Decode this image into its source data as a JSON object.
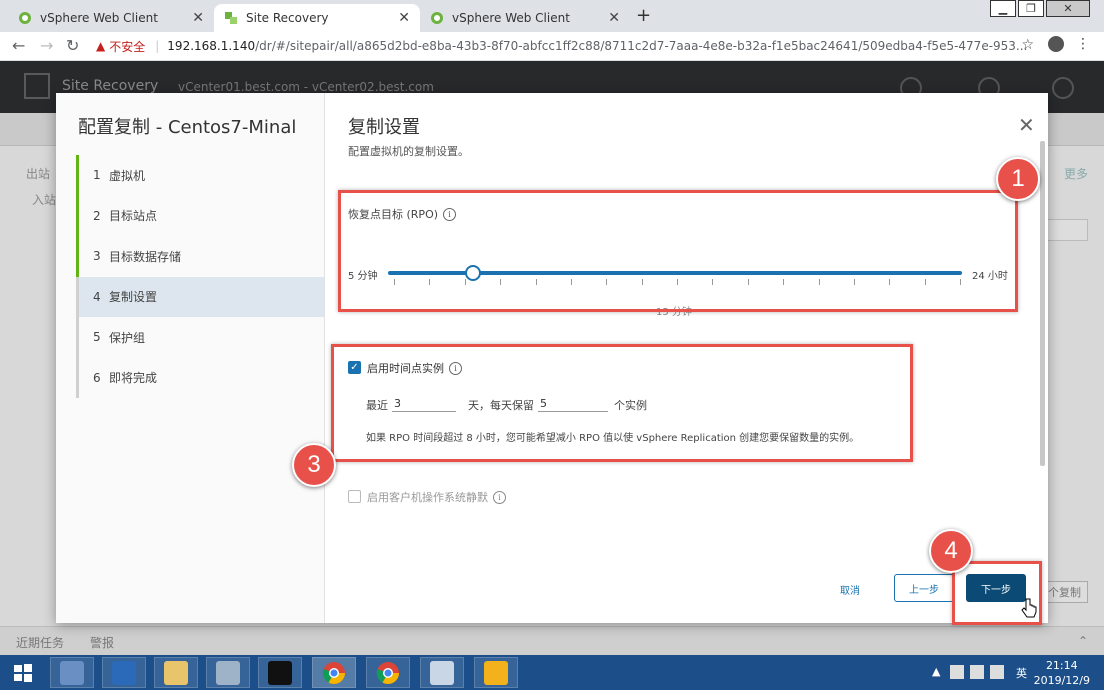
{
  "browser": {
    "tabs": [
      {
        "label": "vSphere Web Client",
        "active": false
      },
      {
        "label": "Site Recovery",
        "active": true
      },
      {
        "label": "vSphere Web Client",
        "active": false
      }
    ],
    "address": {
      "security_label": "不安全",
      "host": "192.168.1.140",
      "path": "/dr/#/sitepair/all/a865d2bd-e8ba-43b3-8f70-abfcc1ff2c88/8711c2d7-7aaa-4e8e-b32a-f1e5bac24641/509edba4-f5e5-477e-953..."
    }
  },
  "app": {
    "title": "Site Recovery",
    "context": "vCenter01.best.com - vCenter02.best.com",
    "bg_left_1": "出站",
    "bg_left_2": "入站",
    "bg_more": "更多",
    "bg_copy": "个复制",
    "tasks": [
      "近期任务",
      "警报"
    ]
  },
  "wizard": {
    "title": "配置复制 - Centos7-Minal",
    "steps": [
      {
        "num": "1",
        "label": "虚拟机",
        "state": "done"
      },
      {
        "num": "2",
        "label": "目标站点",
        "state": "done"
      },
      {
        "num": "3",
        "label": "目标数据存储",
        "state": "done"
      },
      {
        "num": "4",
        "label": "复制设置",
        "state": "current"
      },
      {
        "num": "5",
        "label": "保护组",
        "state": "todo"
      },
      {
        "num": "6",
        "label": "即将完成",
        "state": "todo"
      }
    ],
    "page_title": "复制设置",
    "page_subtitle": "配置虚拟机的复制设置。",
    "rpo": {
      "label": "恢复点目标 (RPO)",
      "min_label": "5 分钟",
      "max_label": "24 小时",
      "value_fraction": 0.147,
      "value_label": "15 分钟"
    },
    "pit": {
      "checked": true,
      "label": "启用时间点实例",
      "prefix": "最近",
      "days_value": "3",
      "mid": "天，每天保留",
      "count_value": "5",
      "suffix": "个实例",
      "note": "如果 RPO 时间段超过 8 小时，您可能希望减小 RPO 值以使 vSphere Replication 创建您要保留数量的实例。"
    },
    "quiesce": {
      "checked": false,
      "label": "启用客户机操作系统静默"
    },
    "buttons": {
      "cancel": "取消",
      "prev": "上一步",
      "next": "下一步"
    }
  },
  "annotations": {
    "color": "#e8514a",
    "badges": [
      "1",
      "3",
      "4"
    ]
  },
  "taskbar": {
    "ime": "英",
    "time": "21:14",
    "date": "2019/12/9"
  }
}
